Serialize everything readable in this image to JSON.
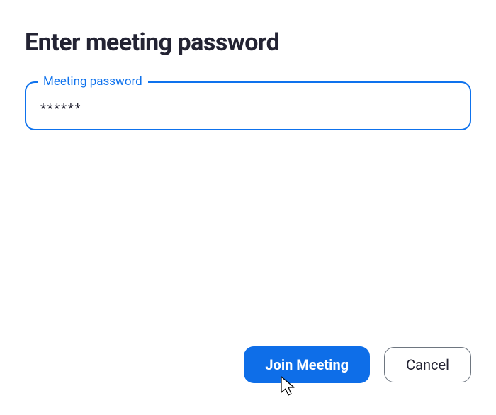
{
  "dialog": {
    "title": "Enter meeting password",
    "password_field": {
      "label": "Meeting password",
      "value": "******"
    },
    "buttons": {
      "primary": "Join Meeting",
      "secondary": "Cancel"
    }
  }
}
